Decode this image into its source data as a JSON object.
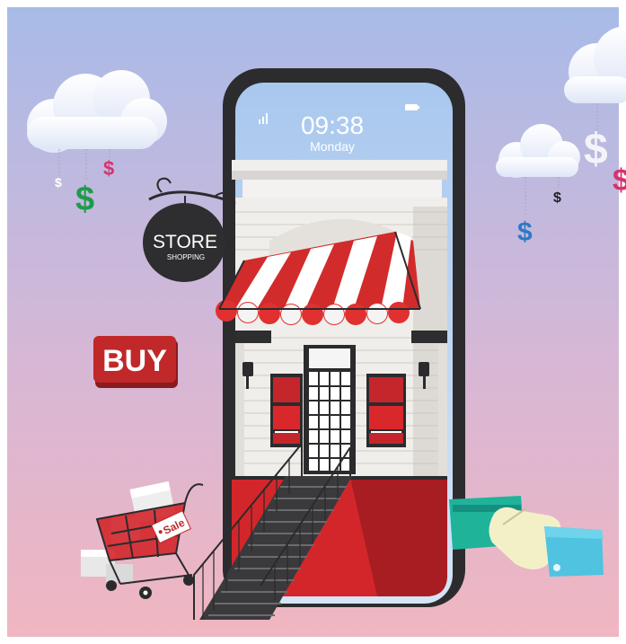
{
  "phone": {
    "time": "09:38",
    "day": "Monday"
  },
  "sign": {
    "title": "STORE",
    "subtitle": "SHOPPING"
  },
  "buy_badge": {
    "label": "BUY"
  },
  "cart": {
    "tag_label": "Sale"
  },
  "currency": {
    "symbol": "$"
  },
  "colors": {
    "sky_top": "#a7bbe8",
    "sky_bottom": "#f1b6c0",
    "awning_red": "#e0302f",
    "badge_red": "#c0282a",
    "card_teal": "#1fb39a",
    "sleeve_blue": "#4fc3e0",
    "dollar_green": "#1e9b4a",
    "dollar_pink": "#d6336c",
    "dollar_blue": "#2f79c4"
  }
}
